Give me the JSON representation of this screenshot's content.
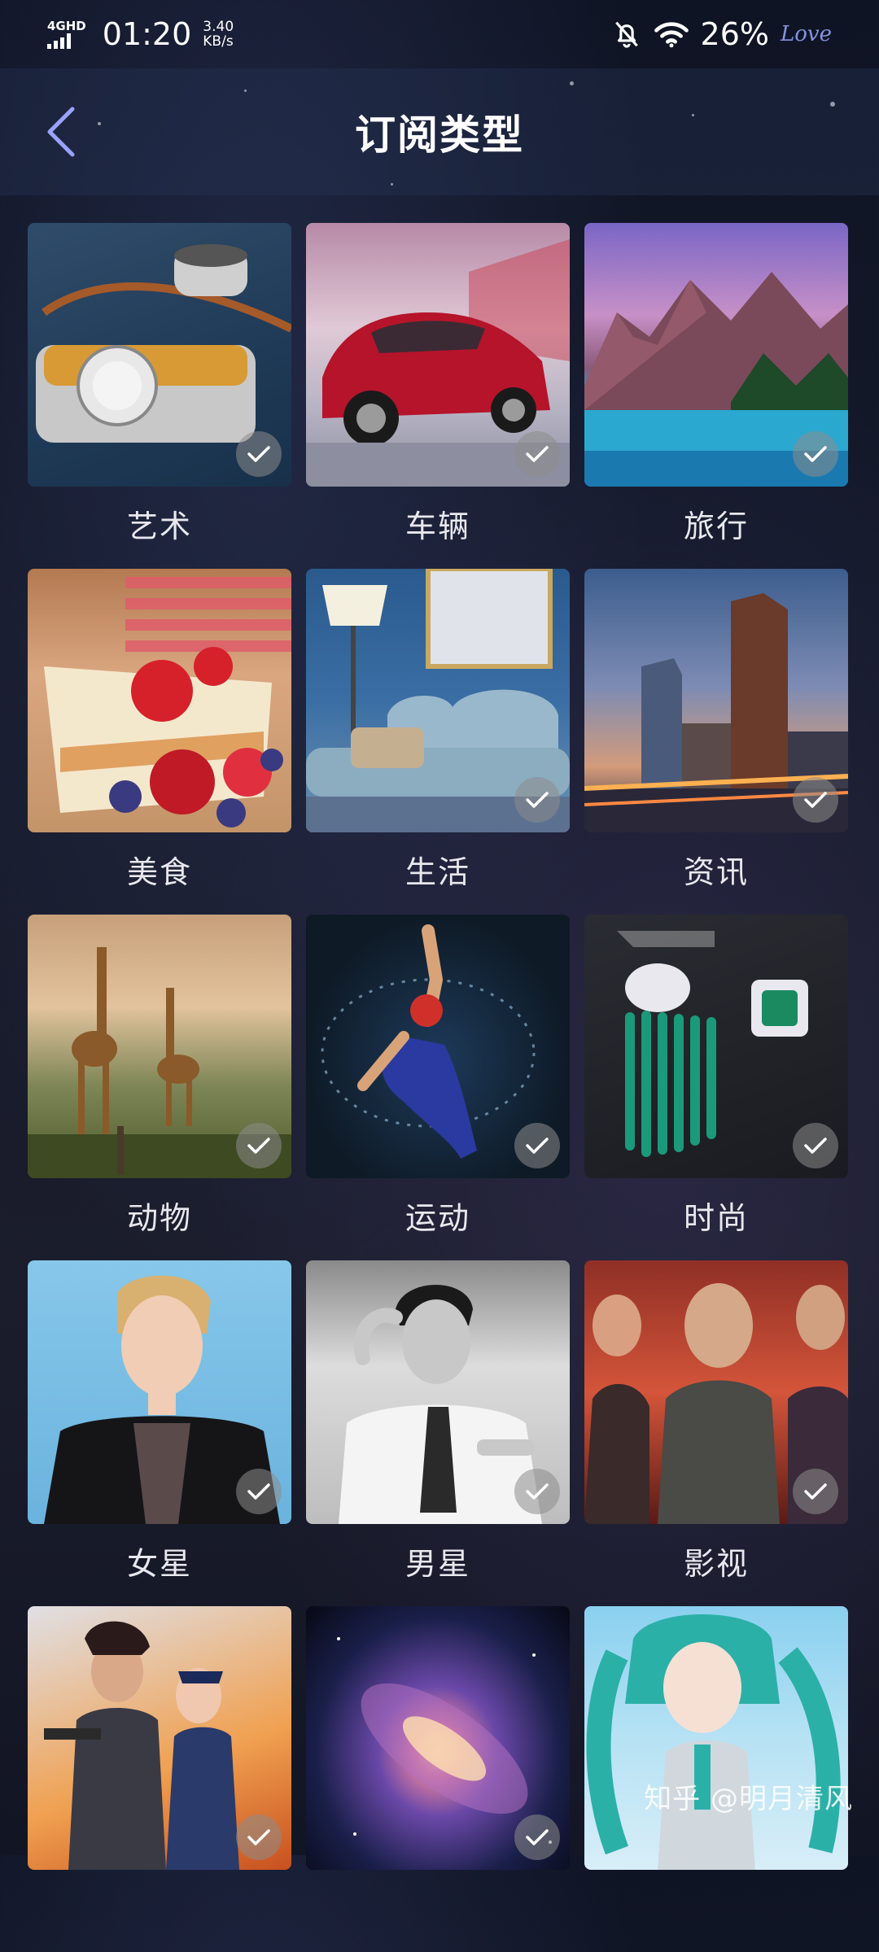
{
  "status_bar": {
    "network": "4GHD",
    "time": "01:20",
    "speed_value": "3.40",
    "speed_unit": "KB/s",
    "battery": "26%",
    "notification_icon": "bell-off-icon",
    "wifi_icon": "wifi-icon",
    "love_badge": "Love"
  },
  "header": {
    "title": "订阅类型",
    "back_icon": "chevron-left-icon"
  },
  "categories": [
    {
      "label": "艺术",
      "scene": "camera",
      "selected": true
    },
    {
      "label": "车辆",
      "scene": "car",
      "selected": true
    },
    {
      "label": "旅行",
      "scene": "mountains",
      "selected": true
    },
    {
      "label": "美食",
      "scene": "cake",
      "selected": true
    },
    {
      "label": "生活",
      "scene": "sofa",
      "selected": true
    },
    {
      "label": "资讯",
      "scene": "city",
      "selected": true
    },
    {
      "label": "动物",
      "scene": "giraffes",
      "selected": true
    },
    {
      "label": "运动",
      "scene": "swimmer",
      "selected": true
    },
    {
      "label": "时尚",
      "scene": "jewelry",
      "selected": true
    },
    {
      "label": "女星",
      "scene": "actress",
      "selected": true
    },
    {
      "label": "男星",
      "scene": "actor",
      "selected": true
    },
    {
      "label": "影视",
      "scene": "movie",
      "selected": true
    },
    {
      "label": "",
      "scene": "game",
      "selected": true
    },
    {
      "label": "",
      "scene": "galaxy",
      "selected": true
    },
    {
      "label": "",
      "scene": "anime",
      "selected": true
    }
  ],
  "watermark": "知乎 @明月清风",
  "colors": {
    "background": "#151a2b",
    "header": "#2a3a5a",
    "check": "#8c8c8c",
    "text": "#ffffff"
  }
}
